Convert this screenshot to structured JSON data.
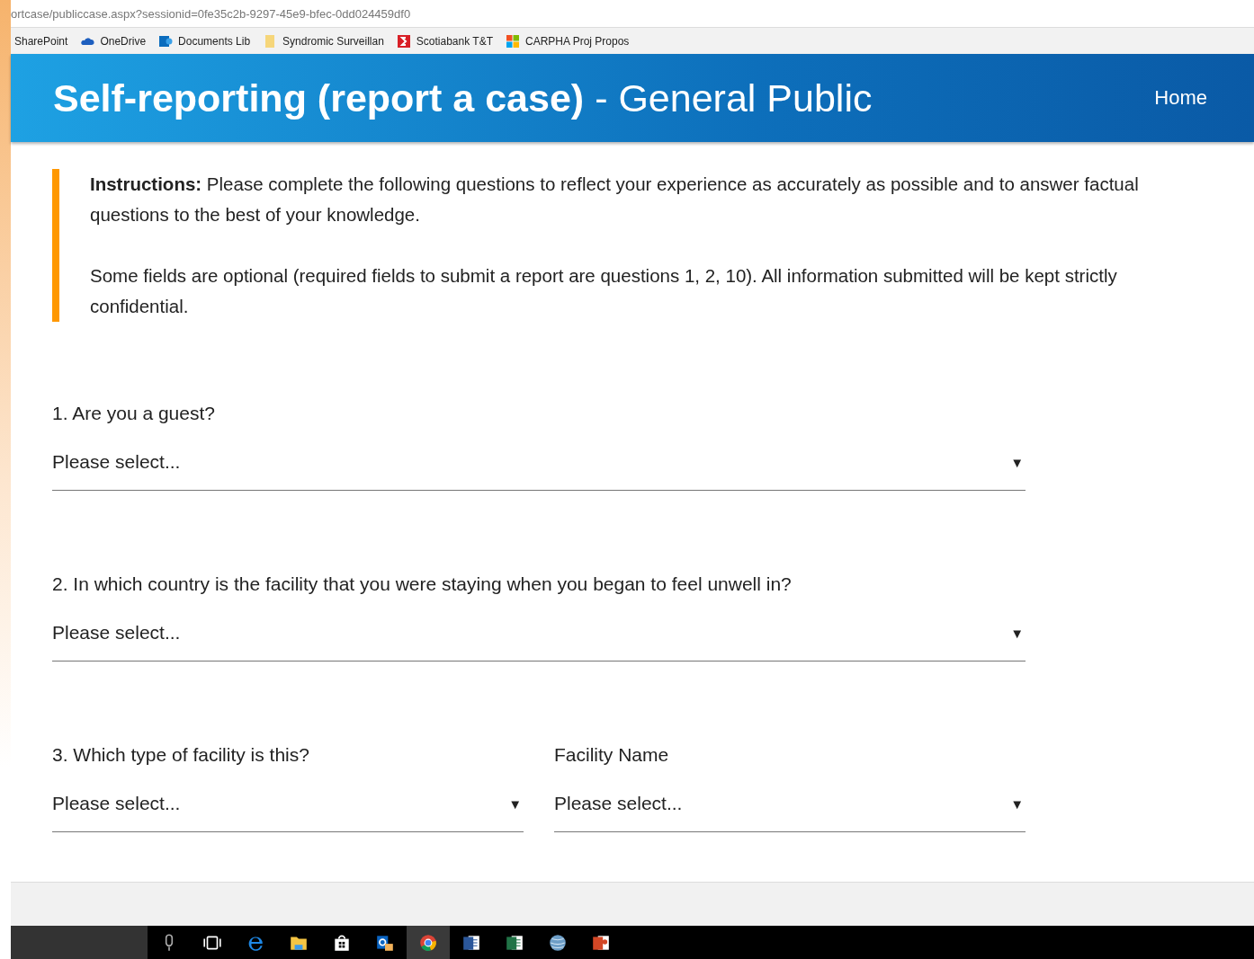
{
  "address_bar": {
    "url": "ortcase/publiccase.aspx?sessionid=0fe35c2b-9297-45e9-bfec-0dd024459df0"
  },
  "bookmarks": [
    {
      "label": "SharePoint",
      "kind": "none"
    },
    {
      "label": "OneDrive",
      "kind": "cloud"
    },
    {
      "label": "Documents Lib",
      "kind": "sharepoint"
    },
    {
      "label": "Syndromic Surveillan",
      "kind": "folder"
    },
    {
      "label": "Scotiabank T&T",
      "kind": "bank"
    },
    {
      "label": "CARPHA Proj Propos",
      "kind": "windows"
    }
  ],
  "header": {
    "title": "**Self-reporting (report a case)** - General Public",
    "home_link": "Home"
  },
  "instructions": [
    "**Instructions:** Please complete the following questions to reflect your experience as accurately as possible and to answer factual questions to the best of your knowledge.",
    "Some fields are optional (required fields to submit a report are questions 1, 2, 10). All information submitted will be kept strictly confidential."
  ],
  "questions": [
    {
      "fields": [
        {
          "label": "1. Are you a guest?",
          "value": "Please select...",
          "caret": "▼"
        }
      ]
    },
    {
      "fields": [
        {
          "label": "2. In which country is the facility that you were staying when you began to feel unwell in?",
          "value": "Please select...",
          "caret": "▼"
        }
      ]
    },
    {
      "fields": [
        {
          "label": "3. Which type of facility is this?",
          "value": "Please select...",
          "caret": "▼"
        },
        {
          "label": "Facility Name",
          "value": "Please select...",
          "caret": "▼"
        }
      ]
    }
  ],
  "taskbar": {
    "items": [
      {
        "kind": "microphone",
        "selected": false
      },
      {
        "kind": "task-view",
        "selected": false
      },
      {
        "kind": "edge",
        "selected": false
      },
      {
        "kind": "folder",
        "selected": false
      },
      {
        "kind": "store",
        "selected": false
      },
      {
        "kind": "outlook",
        "selected": false
      },
      {
        "kind": "chrome",
        "selected": true
      },
      {
        "kind": "word",
        "selected": false
      },
      {
        "kind": "excel",
        "selected": false
      },
      {
        "kind": "globe",
        "selected": false
      },
      {
        "kind": "powerpoint",
        "selected": false
      }
    ]
  }
}
